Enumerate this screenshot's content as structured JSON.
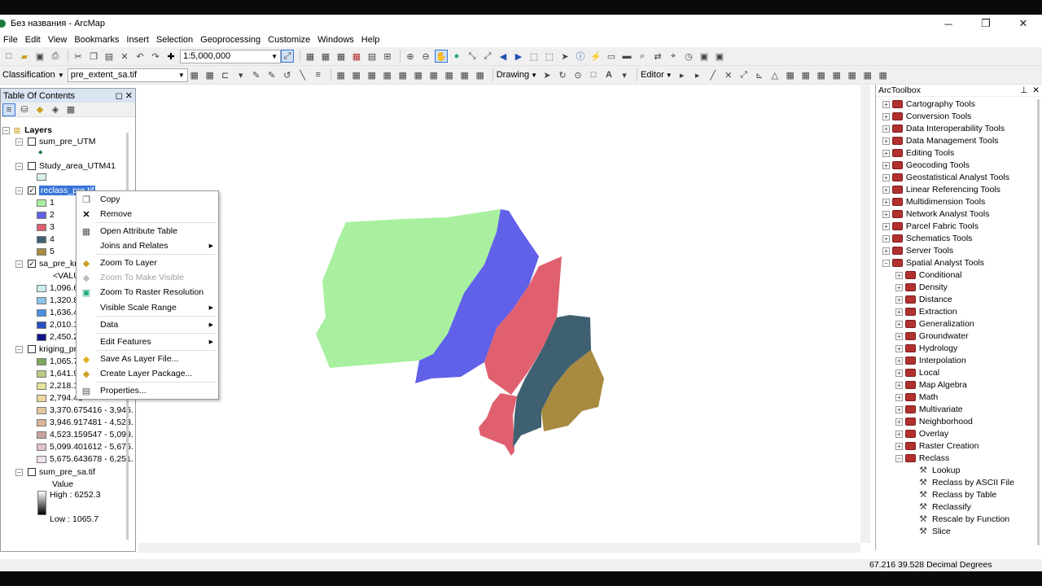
{
  "window": {
    "title": "Без названия - ArcMap"
  },
  "menu": [
    "File",
    "Edit",
    "View",
    "Bookmarks",
    "Insert",
    "Selection",
    "Geoprocessing",
    "Customize",
    "Windows",
    "Help"
  ],
  "toolbar": {
    "scale": "1:5,000,000",
    "classification": "Classification",
    "layer_combo": "pre_extent_sa.tif",
    "drawing": "Drawing",
    "editor": "Editor"
  },
  "toc": {
    "title": "Table Of Contents",
    "layers_label": "Layers",
    "l1": "sum_pre_UTM",
    "l2": "Study_area_UTM41",
    "l3": "reclass_pre.tif",
    "l3_classes": [
      "1",
      "2",
      "3",
      "4",
      "5"
    ],
    "l3_colors": [
      "#a8f0a0",
      "#6060e8",
      "#e06070",
      "#3f6070",
      "#a88a40"
    ],
    "l4": "sa_pre_kri",
    "l4_value": "<VALU",
    "l4_classes": [
      "1,096.67",
      "1,320.89",
      "1,636.45",
      "2,010.14",
      "2,450.26"
    ],
    "l4_colors": [
      "#c8eef0",
      "#8ac4ea",
      "#4a90e0",
      "#2a4ec0",
      "#14148a"
    ],
    "l5": "kriging_pr",
    "l5_classes": [
      "1,065.70",
      "1,641.94",
      "2,218.19",
      "2,794.43",
      "3,370.675416 - 3,946.",
      "3,946.917481 - 4,523.",
      "4,523.159547 - 5,099.",
      "5,099.401612 - 5,675.",
      "5,675.643678 - 6,251."
    ],
    "l5_colors": [
      "#7fa860",
      "#b9cc82",
      "#e6e29a",
      "#eed6a0",
      "#e4c8a0",
      "#d8b498",
      "#c8a4a0",
      "#e0c4cc",
      "#efe0ea"
    ],
    "l6": "sum_pre_sa.tif",
    "l6_value": "Value",
    "l6_high": "High : 6252.3",
    "l6_low": "Low : 1065.7"
  },
  "context_menu": {
    "copy": "Copy",
    "remove": "Remove",
    "open_attr": "Open Attribute Table",
    "joins": "Joins and Relates",
    "zoom_layer": "Zoom To Layer",
    "zoom_visible": "Zoom To Make Visible",
    "zoom_raster": "Zoom To Raster Resolution",
    "visible_scale": "Visible Scale Range",
    "data": "Data",
    "edit_features": "Edit Features",
    "save_layer": "Save As Layer File...",
    "create_package": "Create Layer Package...",
    "properties": "Properties..."
  },
  "arctoolbox": {
    "title": "ArcToolbox",
    "toolboxes": [
      "Cartography Tools",
      "Conversion Tools",
      "Data Interoperability Tools",
      "Data Management Tools",
      "Editing Tools",
      "Geocoding Tools",
      "Geostatistical Analyst Tools",
      "Linear Referencing Tools",
      "Multidimension Tools",
      "Network Analyst Tools",
      "Parcel Fabric Tools",
      "Schematics Tools",
      "Server Tools",
      "Spatial Analyst Tools"
    ],
    "spatial_children": [
      "Conditional",
      "Density",
      "Distance",
      "Extraction",
      "Generalization",
      "Groundwater",
      "Hydrology",
      "Interpolation",
      "Local",
      "Map Algebra",
      "Math",
      "Multivariate",
      "Neighborhood",
      "Overlay",
      "Raster Creation",
      "Reclass"
    ],
    "reclass_tools": [
      "Lookup",
      "Reclass by ASCII File",
      "Reclass by Table",
      "Reclassify",
      "Rescale by Function",
      "Slice"
    ]
  },
  "status": {
    "coords": "67.216  39.528 Decimal Degrees"
  },
  "colors": {
    "zone1": "#a8f0a0",
    "zone2": "#6060e8",
    "zone3": "#e06070",
    "zone4": "#3f6070",
    "zone5": "#a88a40",
    "selection": "#3875d7"
  }
}
